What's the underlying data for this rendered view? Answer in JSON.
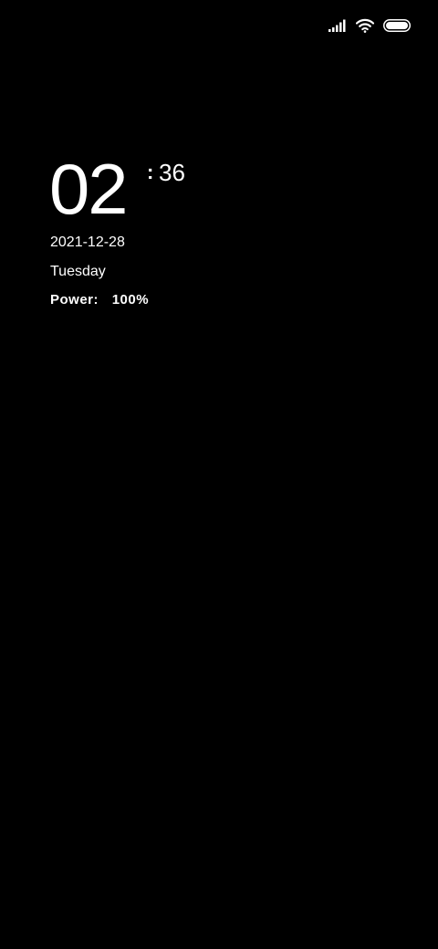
{
  "status_bar": {
    "icons": [
      "signal-icon",
      "wifi-icon",
      "battery-icon"
    ],
    "battery_level": 1.0
  },
  "clock": {
    "hours": "02",
    "separator": ":",
    "minutes": "36"
  },
  "date": "2021-12-28",
  "weekday": "Tuesday",
  "power": {
    "label": "Power:",
    "value": "100%"
  },
  "colors": {
    "background": "#000000",
    "text": "#ffffff"
  }
}
